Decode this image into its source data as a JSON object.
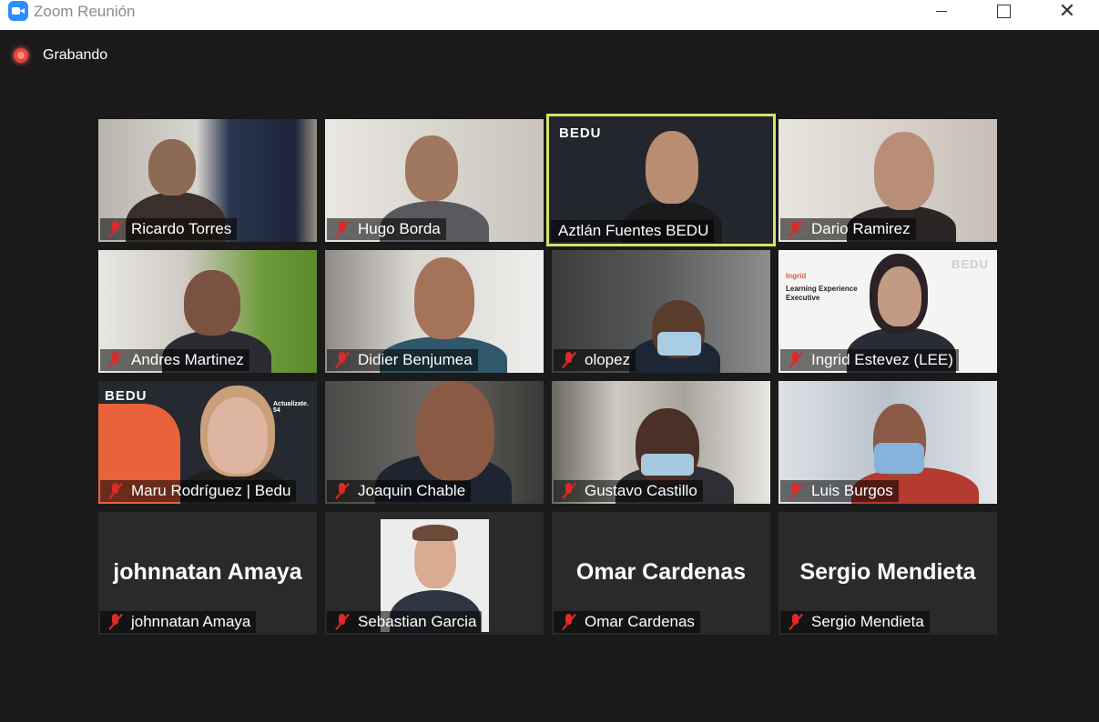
{
  "window": {
    "title": "Zoom Reunión"
  },
  "recording": {
    "label": "Grabando"
  },
  "participants": [
    {
      "name": "Ricardo Torres"
    },
    {
      "name": "Hugo Borda"
    },
    {
      "name": "Aztlán Fuentes BEDU",
      "active_speaker": true
    },
    {
      "name": "Dario Ramirez"
    },
    {
      "name": "Andres Martinez"
    },
    {
      "name": "Didier Benjumea"
    },
    {
      "name": "olopez"
    },
    {
      "name": "Ingrid Estevez (LEE)"
    },
    {
      "name": "Maru Rodríguez | Bedu"
    },
    {
      "name": "Joaquin Chable"
    },
    {
      "name": "Gustavo Castillo"
    },
    {
      "name": "Luis Burgos"
    },
    {
      "name": "johnnatan Amaya",
      "display_name": "johnnatan Amaya"
    },
    {
      "name": "Sebastian Garcia"
    },
    {
      "name": "Omar Cardenas",
      "display_name": "Omar Cardenas"
    },
    {
      "name": "Sergio Mendieta",
      "display_name": "Sergio Mendieta"
    }
  ],
  "branding": {
    "bedu": "BEDU",
    "ingrid_tag": "Ingrid",
    "ingrid_role": "Learning Experience Executive",
    "maru_slogan": "Actualízate. 54"
  },
  "colors": {
    "active_speaker_border": "#d6e36a",
    "muted_icon": "#e02828",
    "recording": "#e6463c"
  }
}
